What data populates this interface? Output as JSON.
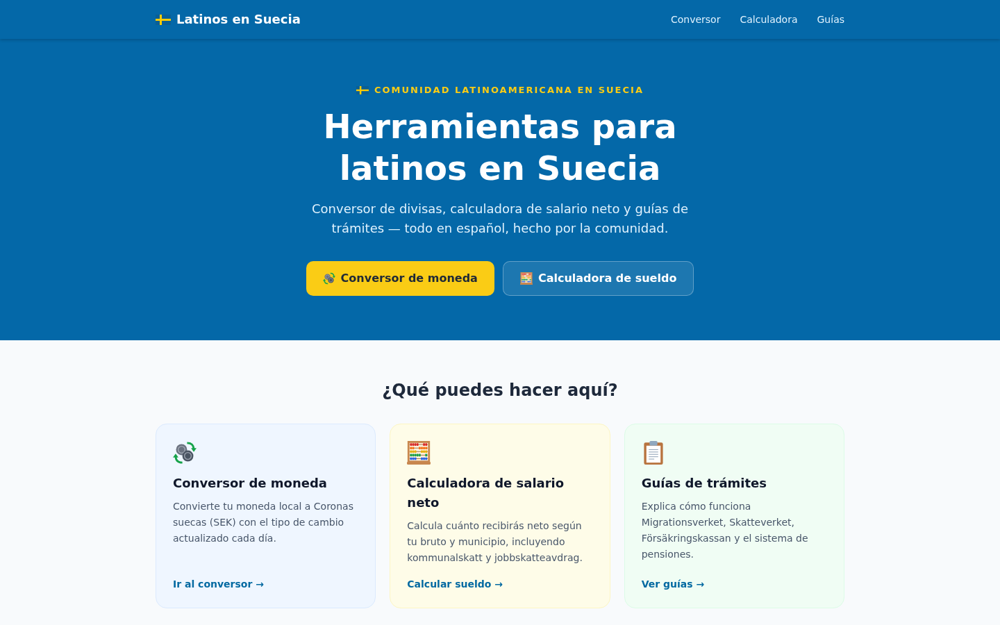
{
  "header": {
    "logo": "Latinos en Suecia",
    "nav": [
      {
        "label": "Conversor"
      },
      {
        "label": "Calculadora"
      },
      {
        "label": "Guías"
      }
    ]
  },
  "hero": {
    "eyebrow": "COMUNIDAD LATINOAMERICANA EN SUECIA",
    "title": "Herramientas para latinos en Suecia",
    "subtitle": "Conversor de divisas, calculadora de salario neto y guías de trámites — todo en español, hecho por la comunidad.",
    "buttons": [
      {
        "label": "Conversor de moneda",
        "kind": "primary"
      },
      {
        "label": "Calculadora de sueldo",
        "kind": "secondary"
      }
    ]
  },
  "features": {
    "heading": "¿Qué puedes hacer aquí?",
    "cards": [
      {
        "title": "Conversor de moneda",
        "description": "Convierte tu moneda local a Coronas suecas (SEK) con el tipo de cambio actualizado cada día.",
        "link": "Ir al conversor →"
      },
      {
        "title": "Calculadora de salario neto",
        "description": "Calcula cuánto recibirás neto según tu bruto y municipio, incluyendo kommunalskatt y jobbskatteavdrag.",
        "link": "Calcular sueldo →"
      },
      {
        "title": "Guías de trámites",
        "description": "Explica cómo funciona Migrationsverket, Skatteverket, Försäkringskassan y el sistema de pensiones.",
        "link": "Ver guías →"
      }
    ]
  }
}
